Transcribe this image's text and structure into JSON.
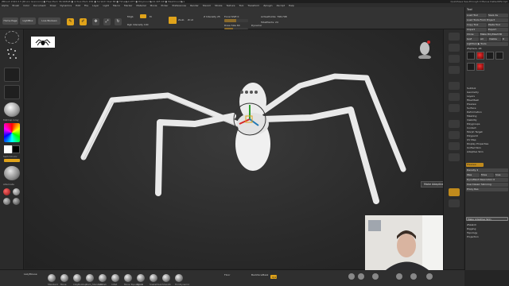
{
  "window": {
    "title": "ZBrush 2022.0.5 [Bruno Giannoni] ● Free Mem 36.998GB ● Active Mem 484 ● Scratch Disk 88 ● Timer▶0.077 ● PolyCount▶24.405 KP ● MeshCount▶1",
    "right_title": "QuickSave  See-through 0  Menus  DefaultZScript"
  },
  "menu": [
    "Alpha",
    "Brush",
    "Color",
    "Document",
    "Draw",
    "Dynamics",
    "Edit",
    "File",
    "Layer",
    "Light",
    "Macro",
    "Marker",
    "Material",
    "Movie",
    "Picker",
    "Preferences",
    "Render",
    "Stencil",
    "Stroke",
    "Texture",
    "Tool",
    "Transform",
    "Zplugin",
    "Zscript",
    "Help"
  ],
  "shelf": {
    "home_page": "Home Page",
    "lightbox": "LightBox",
    "live_boolean": "Live Boolean",
    "edit": "Edit",
    "draw": "Draw",
    "move": "Move",
    "scale": "Scale",
    "rotate": "Rotate",
    "mrgb": "Mrgb",
    "rgb": "Rgb",
    "m": "M",
    "zadd": "Zadd",
    "zsub": "Zsub",
    "zcut": "Zcut",
    "focal_shift_label": "Focal Shift 0",
    "draw_size_label": "Draw Size 64",
    "dynamic": "Dynamic",
    "active_points_label": "ActivePoints: 798,798",
    "total_points_label": "TotalPoints: 24",
    "z_intensity": "Z Intensity 25",
    "rgb_intensity": "Rgb Intensity 100",
    "draw_size_fraction": 0.35,
    "focal_fraction": 0.5
  },
  "left_tray": {
    "material_label": "Stencil",
    "alpha_label": "Alpha Off",
    "texture_label": "Texture Off",
    "gradient_label": "Gradient",
    "switch_color": "SwitchColor",
    "alternate": "Alternate",
    "material_mat": "MatCap Gray",
    "colors": {
      "primary": "#ffffff",
      "secondary": "#000000"
    }
  },
  "viewport": {
    "tooltip": "Make Adaptive 3D Skin",
    "model_color": "#e9e9e9"
  },
  "palette": {
    "title": "Tool",
    "load_tool": "Load Tool",
    "save_as": "Save As",
    "load_tools_from_project": "Load Tools From Project",
    "copy_tool": "Copy Tool",
    "paste_tool": "Paste Tool",
    "import": "Import",
    "export": "Export",
    "clone": "Clone",
    "make_polymesh": "Make PolyMesh3D",
    "goz": "GoZ",
    "all": "All",
    "visible": "Visible",
    "r": "R",
    "lightbox_tools": "Lightbox ▶ Tools",
    "zsphere_label": "ZSphere. 48",
    "sections": [
      "Subtool",
      "Geometry",
      "Layers",
      "FiberMesh",
      "Preview",
      "Surface",
      "Deformation",
      "Masking",
      "Visibility",
      "Polygroups",
      "Contact",
      "Morph Target",
      "Polypaint",
      "UV Map",
      "Display Properties",
      "Unified Skin",
      "Adaptive Skin"
    ],
    "preview_btn": "Preview",
    "density": "Density 2",
    "ires": "IRes",
    "mres": "Mres",
    "sres": "Sres",
    "dynamesh_res": "DynaMesh Resolution 0",
    "use_classic": "Use Classic Skinning",
    "proxy_res": "Proxy Res",
    "make_adaptive": "Make Adaptive Skin",
    "bottom_sections": [
      "ZSketch",
      "Rigging",
      "Topology",
      "Projection"
    ]
  },
  "bottom": {
    "lazy_mouse": "LazyMouse",
    "brushes": [
      "Standard",
      "Move",
      "ClayBuildup",
      "Dam_Standard",
      "hPolish",
      "Inflat",
      "Move Topological",
      "Pinch",
      "SnakeHook",
      "Smooth",
      "TrimDynamic"
    ],
    "floor": "Floor",
    "local": "Local",
    "backface_mask": "BackfaceMask",
    "xyz": "Xyz",
    "frame": "Frame",
    "move": "Move",
    "zoom3d": "Zoom3D",
    "rotate": "Rotate",
    "polyf": "PolyF",
    "solo": "Solo",
    "transp": "Transp"
  }
}
